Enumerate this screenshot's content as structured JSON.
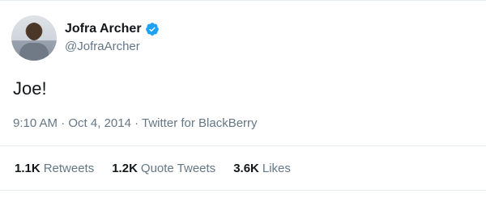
{
  "user": {
    "display_name": "Jofra Archer",
    "handle": "@JofraArcher",
    "verified_icon": "verified-badge-icon",
    "accent_color": "#1da1f2"
  },
  "tweet": {
    "text": "Joe!",
    "time": "9:10 AM",
    "separator": " · ",
    "date": "Oct 4, 2014",
    "source": "Twitter for BlackBerry"
  },
  "stats": {
    "retweets": {
      "count": "1.1K",
      "label": "Retweets"
    },
    "quote_tweets": {
      "count": "1.2K",
      "label": "Quote Tweets"
    },
    "likes": {
      "count": "3.6K",
      "label": "Likes"
    }
  }
}
